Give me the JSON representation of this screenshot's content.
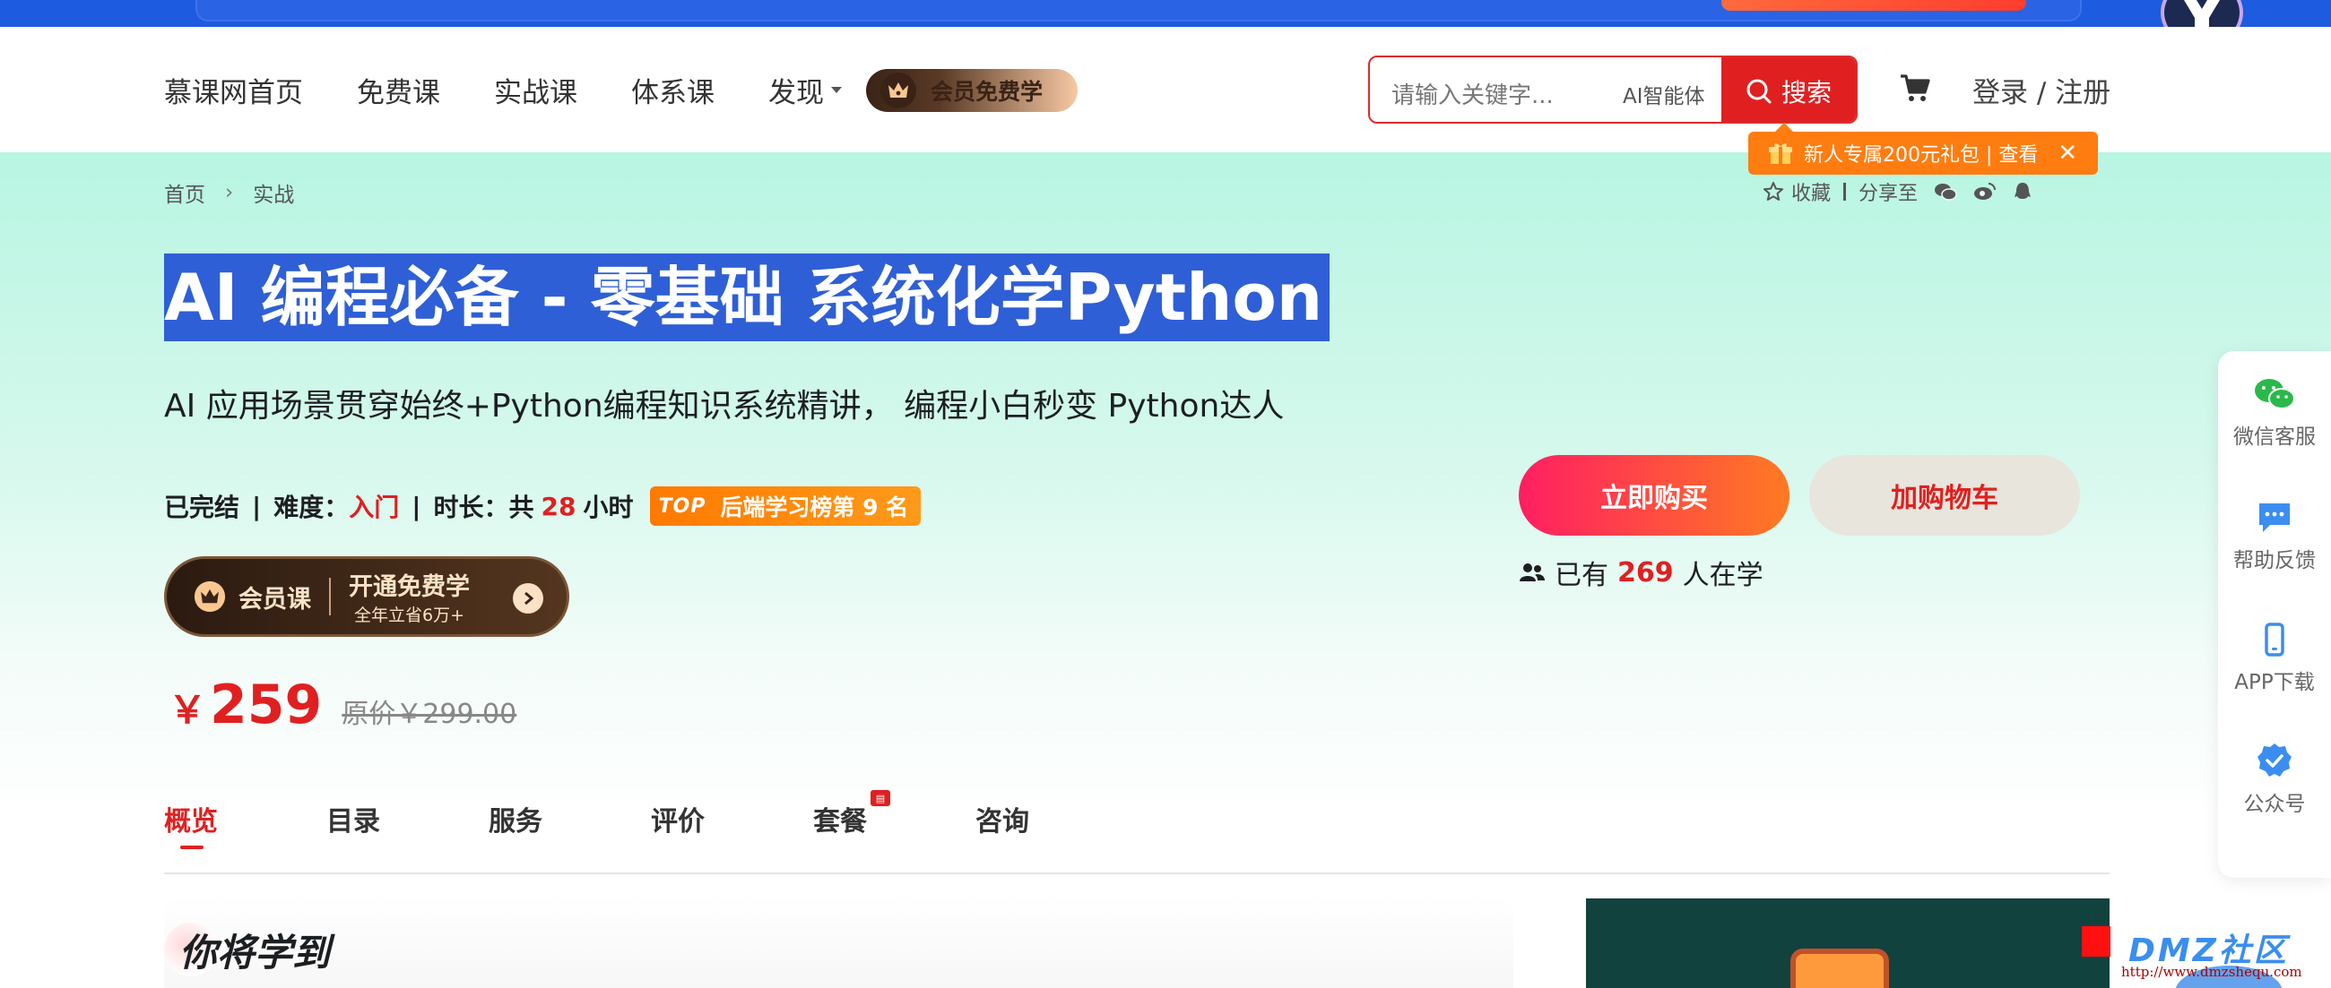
{
  "header": {
    "nav": [
      {
        "label": "慕课网首页"
      },
      {
        "label": "免费课"
      },
      {
        "label": "实战课"
      },
      {
        "label": "体系课"
      },
      {
        "label": "发现",
        "has_dropdown": true
      }
    ],
    "vip_pill": "会员免费学",
    "search": {
      "placeholder": "请输入关键字...",
      "ai_label": "AI智能体",
      "button": "搜索"
    },
    "login": "登录 / 注册"
  },
  "gift_tip": {
    "text": "新人专属200元礼包 | 查看",
    "close": "✕"
  },
  "breadcrumb": {
    "home": "首页",
    "separator": "›",
    "current": "实战"
  },
  "share_bar": {
    "favorite": "收藏",
    "share": "分享至"
  },
  "course": {
    "title": "AI 编程必备 - 零基础 系统化学Python",
    "subtitle": "AI 应用场景贯穿始终+Python编程知识系统精讲， 编程小白秒变 Python达人",
    "status": "已完结",
    "difficulty_label": "难度：",
    "difficulty": "入门",
    "duration_prefix": "时长：共",
    "duration_hours": "28",
    "duration_suffix": "小时",
    "rank_badge_top": "TOP",
    "rank_badge": "后端学习榜第 9 名"
  },
  "vip_course": {
    "label": "会员课",
    "cta": "开通免费学",
    "note": "全年立省6万+"
  },
  "price": {
    "currency": "￥",
    "value": "259",
    "original": "原价￥299.00"
  },
  "actions": {
    "buy": "立即购买",
    "add_cart": "加购物车",
    "learners_prefix": "已有",
    "learners_count": "269",
    "learners_suffix": "人在学"
  },
  "tabs": [
    {
      "label": "概览",
      "active": true
    },
    {
      "label": "目录"
    },
    {
      "label": "服务"
    },
    {
      "label": "评价"
    },
    {
      "label": "套餐",
      "badge": true
    },
    {
      "label": "咨询"
    }
  ],
  "section_title": "你将学到",
  "float_bar": [
    {
      "label": "微信客服",
      "icon": "wechat-icon"
    },
    {
      "label": "帮助反馈",
      "icon": "chat-bubble-icon"
    },
    {
      "label": "APP下载",
      "icon": "phone-icon"
    },
    {
      "label": "公众号",
      "icon": "verified-icon"
    }
  ],
  "watermark": {
    "text": "DMZ社区",
    "url": "http://www.dmzshequ.com"
  },
  "colors": {
    "accent_red": "#e02020",
    "brand_blue": "#1d5be0",
    "selection_blue": "#2e5fd6",
    "gift_orange": "#ff7d10"
  }
}
